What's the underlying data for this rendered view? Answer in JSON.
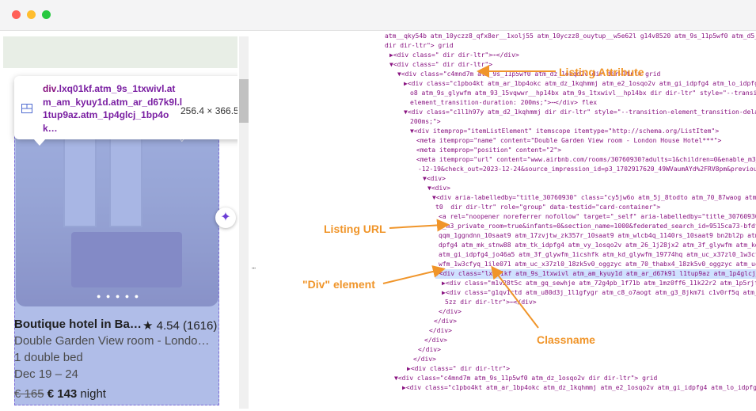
{
  "window": {
    "dot_colors": [
      "#ff5f57",
      "#ffbd2e",
      "#28c840"
    ]
  },
  "tooltip": {
    "element_tag": "div",
    "class_text": ".lxq01kf.atm_9s_1txwivl.atm_am_kyuy1d.atm_ar_d67k9l.l1tup9az.atm_1p4glcj_1bp4ok…",
    "size": "256.4 × 366.58",
    "icon": "flex-layout-icon"
  },
  "listing": {
    "title": "Boutique hotel in Ba…",
    "rating": "★ 4.54 (1616)",
    "room": "Double Garden View room - Londo…",
    "beds": "1 double bed",
    "dates": "Dec 19 – 24",
    "old_price": "€ 165",
    "new_price": "€ 143",
    "price_suffix": " night",
    "heart_icon": "heart-icon",
    "sparkle_icon": "sparkle-icon"
  },
  "annotations": {
    "listing_attribute": "Listing Attribute",
    "listing_url": "Listing URL",
    "div_element": "\"Div\" element",
    "classname": "Classname"
  },
  "dom_lines": [
    "atm__qky54b atm_10yczz8_qfx8er__1xolj55 atm_10yczz8_ouytup__w5e62l g14v8520 atm_9s_11p5wf0 atm_d5_j5tqy",
    "dir dir-ltr\"> grid",
    "▶<div class=\" dir dir-ltr\">⋯</div>",
    "▼<div class=\" dir dir-ltr\">",
    "▼<div class=\"c4mnd7m atm_9s_11p5wf0 atm_dz_1osqo2v dir dir-ltr\"> grid",
    "▶<div class=\"c1pbo4kt atm_ar_1bp4okc atm_dz_1kqhmmj atm_e2_1osqo2v atm_gi_idpfg4 atm_lo_idpfg4 atm_v",
    "o8 atm_9s_glywfm atm_93_15vqwwr__hp14bx atm_9s_1txwivl__hp14bx dir dir-ltr\" style=\"--transition-ele",
    "element_transition-duration: 200ms;\">⋯</div> flex",
    "▼<div class=\"c1l1h97y atm_d2_1kqhmmj dir dir-ltr\" style=\"--transition-element_transition-delay: 0ms;",
    "200ms;\">",
    "▼<div itemprop=\"itemListElement\" itemscope itemtype=\"http://schema.org/ListItem\">",
    "<meta itemprop=\"name\" content=\"Double Garden View room - London House Hotel***\">",
    "<meta itemprop=\"position\" content=\"2\">",
    "<meta itemprop=\"url\" content=\"www.airbnb.com/rooms/30760930?adults=1&children=0&enable_m3_priva",
    "-12-19&check_out=2023-12-24&source_impression_id=p3_1702917620_49WVaumAYd%2FRV8pm&previous_page",
    "▼<div>",
    "▼<div>",
    "▼<div aria-labelledby=\"title_30760930\" class=\"cy5jw6o atm_5j_8todto atm_70_87waog atm_j3_1u6:",
    "t0  dir dir-ltr\" role=\"group\" data-testid=\"card-container\">",
    "<a rel=\"noopener noreferrer nofollow\" target=\"_self\" aria-labelledby=\"title_30760930\" hre",
    "e_m3_private_room=true&infants=0&section_name=1000&federated_search_id=9515ca73-bfdf-49f1-",
    "qqm_1ggndnn_10saat9 atm_17zvjtw_zk357r_10saat9 atm_wlcb4q_1140rs_10saat9 bn2bl2p atm_5j_8t",
    "dpfg4 atm_mk_stnw88 atm_tk_idpfg4 atm_vy_1osqo2v atm_26_1j28jx2 atm_3f_glywfm atm_kd_glywf",
    "atm_gi_idpfg4_jo46a5 atm_3f_glywfm_1icshfk atm_kd_glywfm_19774hq atm_uc_x37zl0_1w3cfyq_og",
    "wfm_1w3cfyq_1ile071 atm_uc_x37zl0_18zk5v0_oggzyc atm_70_thabx4_18zk5v0_oggzyc atm_uc_glywf",
    "▼<div class=\"lxq01kf atm_9s_1txwivl atm_am_kyuy1d atm_ar_d67k91 l1tup9az atm_1p4glcj_1bp4ok",
    "▶<div class=\"m1v28t5c atm_gq_sewhje atm_72g4pb_1f71b atm_1mz0ff6_11k22r2 atm_1p5rjfj_h2n",
    "▶<div class=\"g1qv1ctd atm_u80d3j_1l1gfygr atm_c8_o7aogt atm_g3_8jkm7i c1v0rf5q atm_9s_11p5",
    "5zz dir dir-ltr\">⋯</div>",
    "</div>",
    "</div>",
    "</div>",
    "</div>",
    "</div>",
    "</div>",
    "▶<div class=\" dir dir-ltr\">",
    "▼<div class=\"c4mnd7m atm_9s_11p5wf0 atm_dz_1osqo2v dir dir-ltr\"> grid",
    "▶<div class=\"c1pbo4kt atm_ar_1bp4okc atm_dz_1kqhmmj atm_e2_1osqo2v atm_gi_idpfg4 atm_lo_idpfg4 atm_v"
  ],
  "gutter_marker": "⋯"
}
